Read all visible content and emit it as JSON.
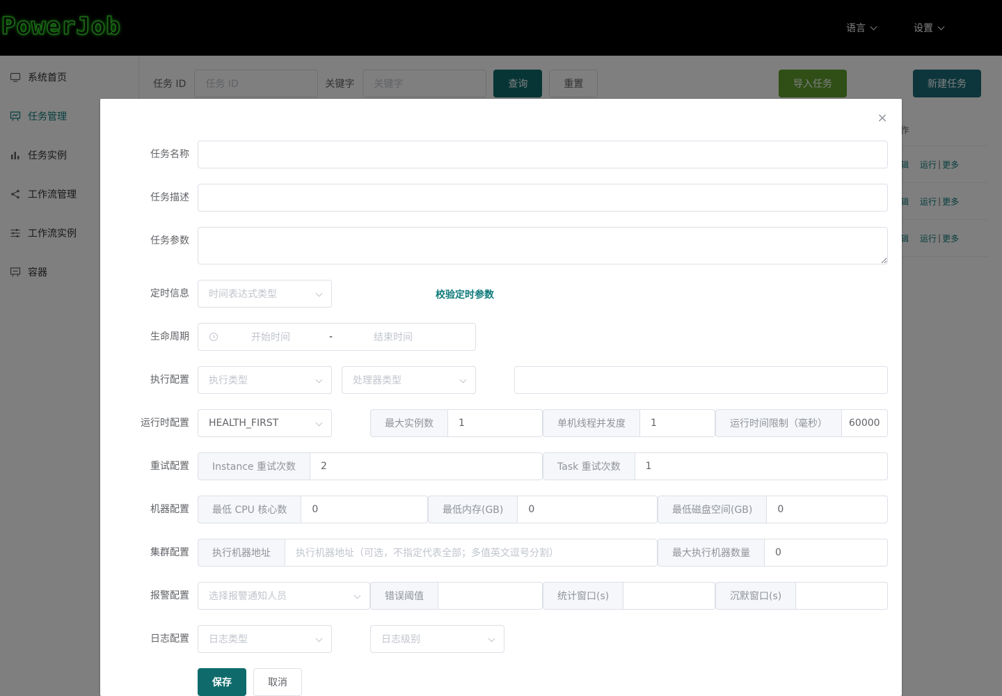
{
  "header": {
    "logo": "PowerJob",
    "menu_language": "语言",
    "menu_settings": "设置"
  },
  "sidebar": {
    "items": [
      {
        "label": "系统首页",
        "icon": "monitor-icon"
      },
      {
        "label": "任务管理",
        "icon": "chart-board-icon",
        "active": true
      },
      {
        "label": "任务实例",
        "icon": "bar-chart-icon"
      },
      {
        "label": "工作流管理",
        "icon": "share-icon"
      },
      {
        "label": "工作流实例",
        "icon": "sliders-icon"
      },
      {
        "label": "容器",
        "icon": "presentation-icon"
      }
    ]
  },
  "search": {
    "job_id_label": "任务 ID",
    "job_id_placeholder": "任务 ID",
    "keyword_label": "关键字",
    "keyword_placeholder": "关键字",
    "query_button": "查询",
    "reset_button": "重置",
    "import_button": "导入任务",
    "new_button": "新建任务"
  },
  "table_fragment": {
    "header_fragment": "作",
    "rows": [
      {
        "edit": "辑",
        "run": "运行",
        "sep": "|",
        "more": "更多"
      },
      {
        "edit": "辑",
        "run": "运行",
        "sep": "|",
        "more": "更多"
      },
      {
        "edit": "辑",
        "run": "运行",
        "sep": "|",
        "more": "更多"
      }
    ]
  },
  "dialog": {
    "close_symbol": "×",
    "name_label": "任务名称",
    "desc_label": "任务描述",
    "params_label": "任务参数",
    "timing_label": "定时信息",
    "timing_type_placeholder": "时间表达式类型",
    "validate_timing": "校验定时参数",
    "lifecycle_label": "生命周期",
    "start_time_placeholder": "开始时间",
    "range_separator": "-",
    "end_time_placeholder": "结束时间",
    "exec_label": "执行配置",
    "exec_type_placeholder": "执行类型",
    "processor_type_placeholder": "处理器类型",
    "runtime_label": "运行时配置",
    "dispatch_strategy": "HEALTH_FIRST",
    "max_instance_label": "最大实例数",
    "max_instance_value": "1",
    "thread_concurrency_label": "单机线程并发度",
    "thread_concurrency_value": "1",
    "time_limit_label": "运行时间限制（毫秒）",
    "time_limit_value": "60000",
    "retry_label": "重试配置",
    "instance_retry_label": "Instance 重试次数",
    "instance_retry_value": "2",
    "task_retry_label": "Task 重试次数",
    "task_retry_value": "1",
    "machine_label": "机器配置",
    "min_cpu_label": "最低 CPU 核心数",
    "min_cpu_value": "0",
    "min_memory_label": "最低内存(GB)",
    "min_memory_value": "0",
    "min_disk_label": "最低磁盘空间(GB)",
    "min_disk_value": "0",
    "cluster_label": "集群配置",
    "designated_workers_label": "执行机器地址",
    "designated_workers_placeholder": "执行机器地址（可选，不指定代表全部；多值英文逗号分割）",
    "max_workers_label": "最大执行机器数量",
    "max_workers_value": "0",
    "alarm_label": "报警配置",
    "alarm_users_placeholder": "选择报警通知人员",
    "error_threshold_label": "错误阈值",
    "stat_window_label": "统计窗口(s)",
    "silence_window_label": "沉默窗口(s)",
    "log_label": "日志配置",
    "log_type_placeholder": "日志类型",
    "log_level_placeholder": "日志级别",
    "save_button": "保存",
    "cancel_button": "取消"
  }
}
